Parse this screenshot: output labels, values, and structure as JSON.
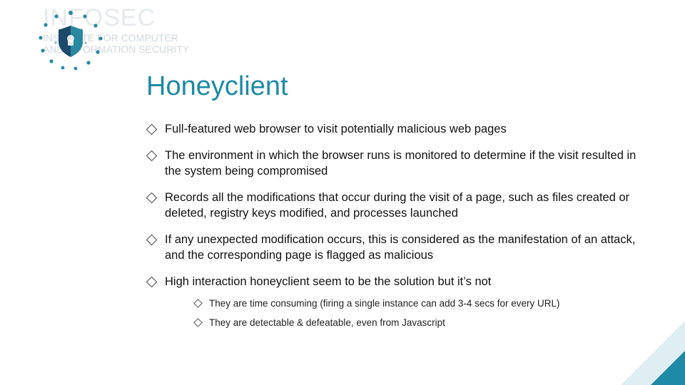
{
  "watermark": {
    "line1": "INFOSEC",
    "line2": "INSTITUTE FOR COMPUTER",
    "line3": "AND INFORMATION SECURITY"
  },
  "title": "Honeyclient",
  "bullets": [
    {
      "text": "Full-featured web browser to visit potentially malicious web pages"
    },
    {
      "text": "The environment in which the browser runs is monitored to determine if the visit resulted in the system being compromised"
    },
    {
      "text": "Records all the modifications that occur during the visit of a page, such as files created or deleted, registry keys modified, and processes launched"
    },
    {
      "text": "If any unexpected modification occurs, this is considered as the manifestation of an attack, and the corresponding page is flagged as malicious"
    },
    {
      "text": "High interaction honeyclient seem to be the solution but it’s not",
      "sub": [
        "They are time consuming (firing a single instance can add 3-4 secs for every URL)",
        "They are detectable & defeatable, even from Javascript"
      ]
    }
  ]
}
